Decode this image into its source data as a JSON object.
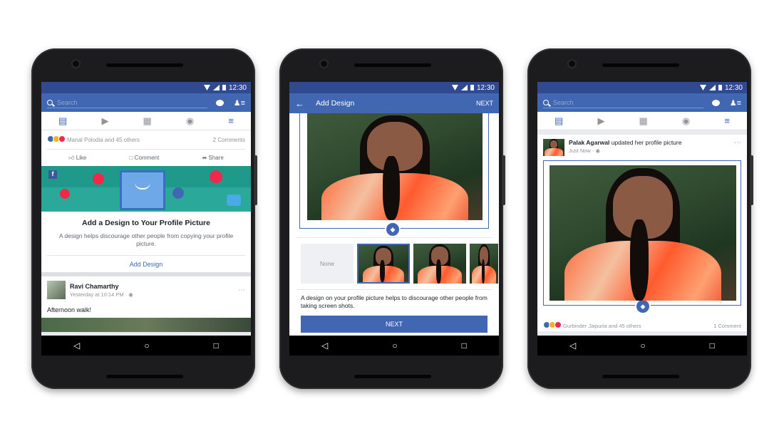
{
  "status_time": "12:30",
  "icons": {
    "search": "search-icon",
    "messenger": "messenger-icon",
    "friends": "friend-requests-icon",
    "back": "back-arrow-icon",
    "nav_back": "nav-back-icon",
    "nav_home": "nav-home-icon",
    "nav_recent": "nav-recents-icon"
  },
  "colors": {
    "brand_blue": "#4267b2",
    "status_blue": "#2f4a8f",
    "bg_grey": "#e9ebee"
  },
  "phone1": {
    "search_placeholder": "Search",
    "reactions_text": "Manal Polodia and 45 others",
    "comments_count": "2 Comments",
    "actions": [
      "Like",
      "Comment",
      "Share"
    ],
    "promo_title": "Add a Design to Your Profile Picture",
    "promo_body": "A design helps discourage other people from copying your profile picture.",
    "promo_link": "Add Design",
    "post_author": "Ravi Chamarthy",
    "post_time": "Yesterday at 10:14 PM ·",
    "post_text": "Afternoon walk!"
  },
  "phone2": {
    "title": "Add Design",
    "next_label": "NEXT",
    "none_label": "None",
    "description": "A design on your profile picture helps to discourage other people from taking screen shots.",
    "next_button": "NEXT"
  },
  "phone3": {
    "search_placeholder": "Search",
    "post_author": "Palak Agarwal",
    "post_action": "updated her profile picture",
    "post_time": "Just Now ·",
    "reactions_text": "Gurbinder Jaipuria and 45 others",
    "comments_count": "1 Comment"
  }
}
